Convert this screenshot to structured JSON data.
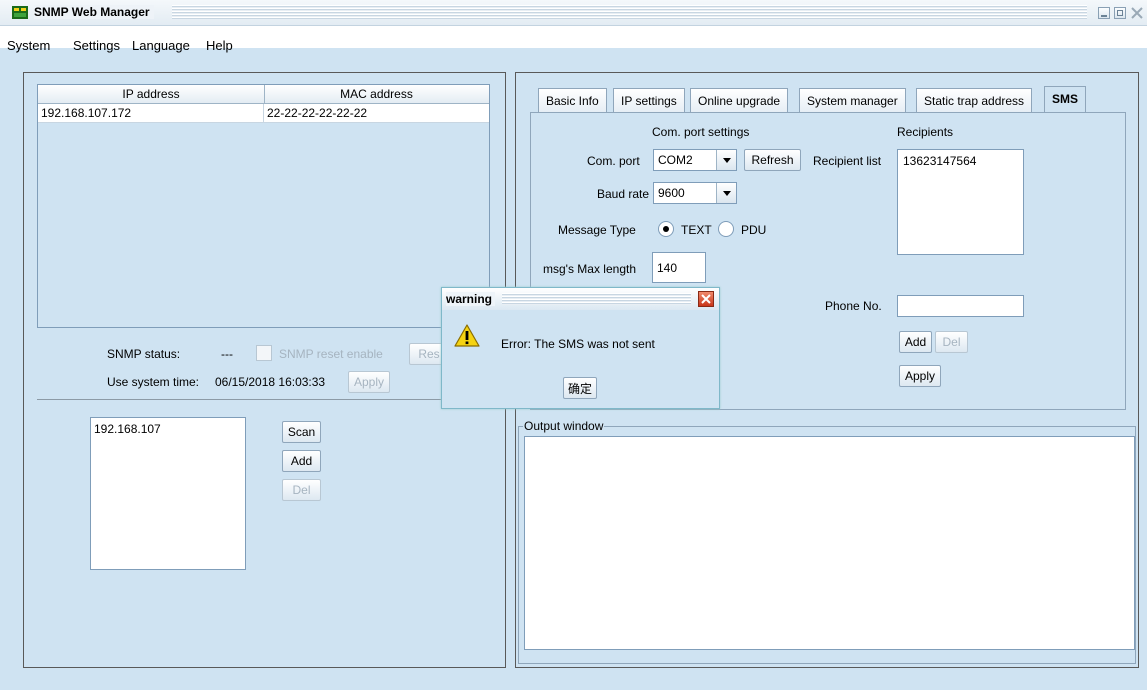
{
  "window": {
    "title": "SNMP Web Manager"
  },
  "menu": [
    "System",
    "Settings",
    "Language",
    "Help"
  ],
  "device_table": {
    "columns": [
      "IP address",
      "MAC address"
    ],
    "rows": [
      [
        "192.168.107.172",
        "22-22-22-22-22-22"
      ]
    ]
  },
  "status": {
    "snmp_label": "SNMP status:",
    "snmp_value": "---",
    "reset_label": "SNMP reset enable",
    "reset_button": "Res",
    "time_label": "Use system time:",
    "time_value": "06/15/2018 16:03:33",
    "apply": "Apply"
  },
  "scan": {
    "items": [
      "192.168.107"
    ],
    "scan_button": "Scan",
    "add_button": "Add",
    "del_button": "Del"
  },
  "tabs": [
    "Basic Info",
    "IP settings",
    "Online upgrade",
    "System manager",
    "Static trap address",
    "SMS"
  ],
  "sms": {
    "com_section": "Com. port settings",
    "com_port_label": "Com. port",
    "com_port_value": "COM2",
    "refresh": "Refresh",
    "baud_label": "Baud rate",
    "baud_value": "9600",
    "msg_type_label": "Message Type",
    "text_option": "TEXT",
    "pdu_option": "PDU",
    "max_len_label": "msg's Max length",
    "max_len_value": "140",
    "recipients_section": "Recipients",
    "recipient_list_label": "Recipient list",
    "recipients": [
      "13623147564"
    ],
    "phone_label": "Phone No.",
    "phone_value": "",
    "add": "Add",
    "del": "Del",
    "apply": "Apply"
  },
  "output": {
    "title": "Output window"
  },
  "dialog": {
    "title": "warning",
    "message": "Error: The SMS was not sent",
    "ok": "确定"
  }
}
